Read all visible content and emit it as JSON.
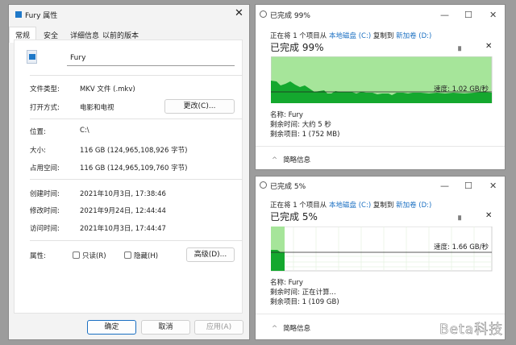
{
  "properties": {
    "title": "Fury 属性",
    "tabs": [
      "常规",
      "安全",
      "详细信息",
      "以前的版本"
    ],
    "filename": "Fury",
    "rows": [
      {
        "label": "文件类型:",
        "value": "MKV 文件 (.mkv)"
      },
      {
        "label": "打开方式:",
        "value": "电影和电视"
      },
      {
        "label": "位置:",
        "value": "C:\\"
      },
      {
        "label": "大小:",
        "value": "116 GB (124,965,108,926 字节)"
      },
      {
        "label": "占用空间:",
        "value": "116 GB (124,965,109,760 字节)"
      },
      {
        "label": "创建时间:",
        "value": "2021年10月3日, 17:38:46"
      },
      {
        "label": "修改时间:",
        "value": "2021年9月24日, 12:44:44"
      },
      {
        "label": "访问时间:",
        "value": "2021年10月3日, 17:44:47"
      }
    ],
    "change_button": "更改(C)...",
    "attributes_label": "属性:",
    "readonly": "只读(R)",
    "hidden": "隐藏(H)",
    "advanced": "高级(D)...",
    "ok": "确定",
    "cancel": "取消",
    "apply": "应用(A)"
  },
  "copy1": {
    "title": "已完成 99%",
    "prefix": "正在将 1 个项目从 ",
    "src": "本地磁盘 (C:)",
    "mid": " 复制到 ",
    "dst": "新加卷 (D:)",
    "heading": "已完成 99%",
    "progress": 99,
    "speed": "速度: 1.02 GB/秒",
    "name": "名称: Fury",
    "time": "剩余时间: 大约 5 秒",
    "items": "剩余项目: 1 (752 MB)",
    "details": "简略信息"
  },
  "copy2": {
    "title": "已完成 5%",
    "prefix": "正在将 1 个项目从 ",
    "src": "本地磁盘 (C:)",
    "mid": " 复制到 ",
    "dst": "新加卷 (D:)",
    "heading": "已完成 5%",
    "progress": 5,
    "speed": "速度: 1.66 GB/秒",
    "name": "名称: Fury",
    "time": "剩余时间: 正在计算...",
    "items": "剩余项目: 1 (109 GB)",
    "details": "简略信息"
  },
  "watermark": "Beta科技",
  "colors": {
    "fill_light": "#a6e59a",
    "fill_dark": "#14a82e",
    "link": "#1a6fc2"
  }
}
